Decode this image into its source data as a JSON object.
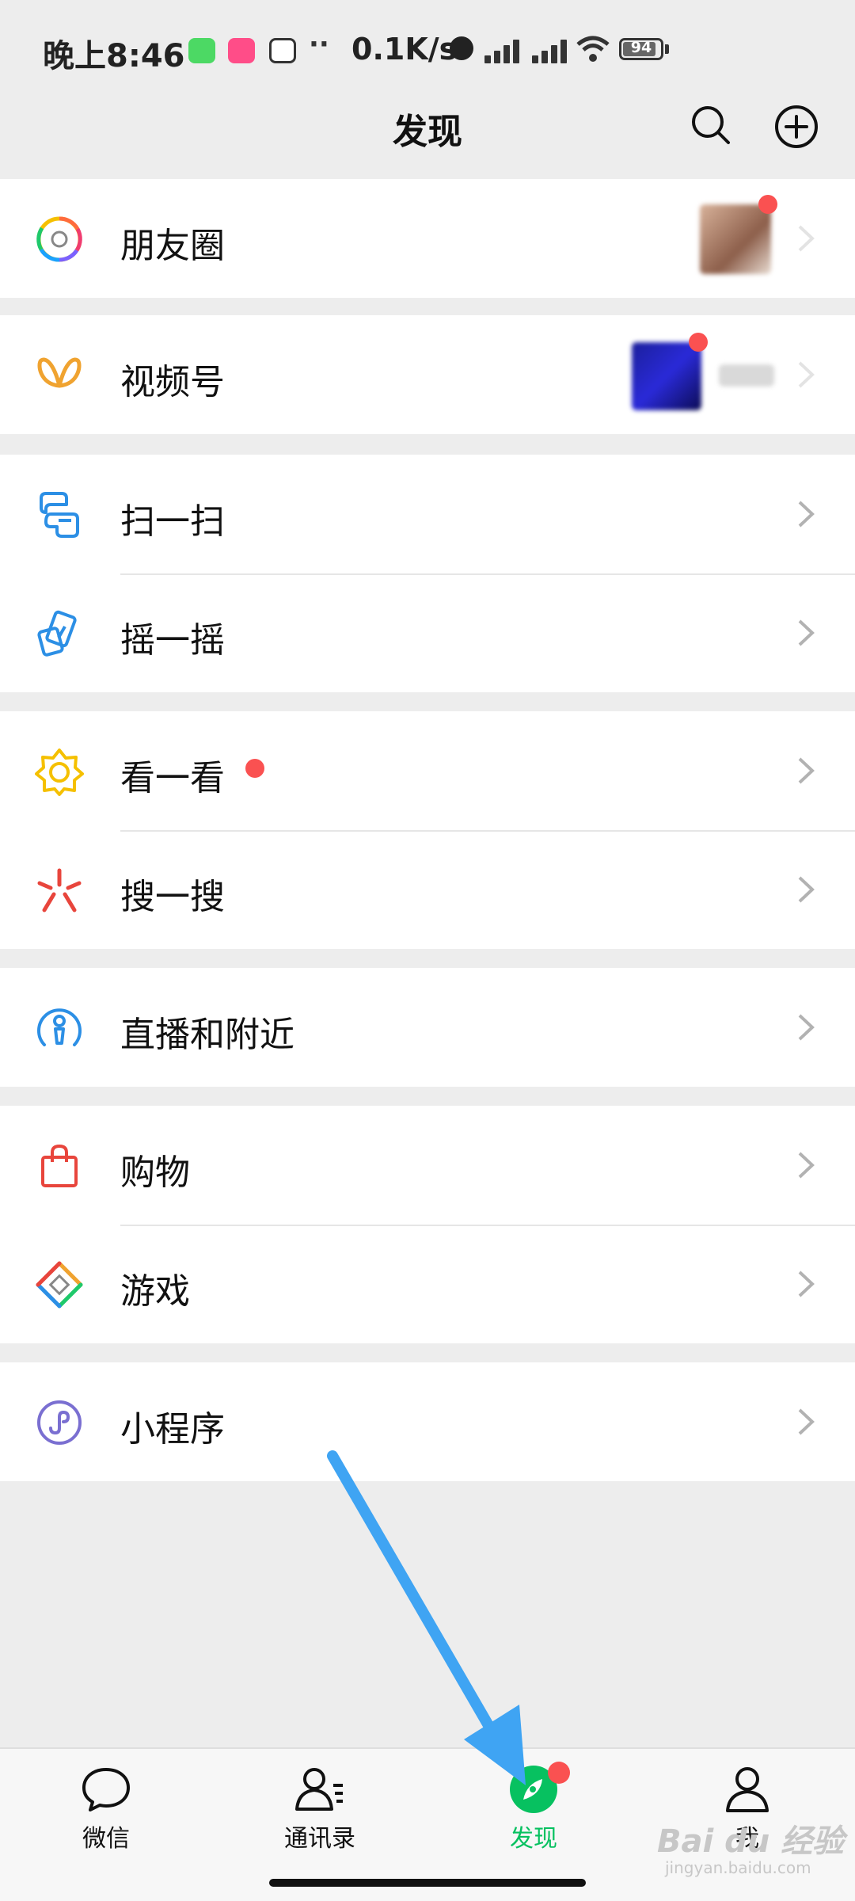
{
  "status_bar": {
    "time": "晚上8:46",
    "network_speed": "0.1K/s",
    "battery_level": "94",
    "app_icon_colors": [
      "#4cd964",
      "#ff4d88",
      "#333333"
    ]
  },
  "nav": {
    "title": "发现",
    "search_icon": "search-icon",
    "add_icon": "plus-circle-icon"
  },
  "groups": [
    {
      "items": [
        {
          "label": "朋友圈",
          "icon": "moments-aperture-icon",
          "has_thumbnail": true,
          "has_red_dot": true
        }
      ]
    },
    {
      "items": [
        {
          "label": "视频号",
          "icon": "channels-butterfly-icon",
          "has_thumbnail": true,
          "has_red_dot": true
        }
      ]
    },
    {
      "items": [
        {
          "label": "扫一扫",
          "icon": "scan-icon"
        },
        {
          "label": "摇一摇",
          "icon": "shake-icon"
        }
      ]
    },
    {
      "items": [
        {
          "label": "看一看",
          "icon": "top-stories-icon",
          "has_red_dot": true
        },
        {
          "label": "搜一搜",
          "icon": "search-spark-icon"
        }
      ]
    },
    {
      "items": [
        {
          "label": "直播和附近",
          "icon": "live-nearby-icon"
        }
      ]
    },
    {
      "items": [
        {
          "label": "购物",
          "icon": "shopping-bag-icon"
        },
        {
          "label": "游戏",
          "icon": "game-diamond-icon"
        }
      ]
    },
    {
      "items": [
        {
          "label": "小程序",
          "icon": "mini-program-icon"
        }
      ]
    }
  ],
  "tab_bar": {
    "tabs": [
      {
        "label": "微信",
        "icon": "chat-bubble-icon",
        "active": false
      },
      {
        "label": "通讯录",
        "icon": "contacts-icon",
        "active": false
      },
      {
        "label": "发现",
        "icon": "compass-icon",
        "active": true,
        "has_red_dot": true
      },
      {
        "label": "我",
        "icon": "person-icon",
        "active": false
      }
    ]
  },
  "colors": {
    "accent_green": "#07c160",
    "badge_red": "#fa5151",
    "annotation_arrow": "#3fa4f3",
    "background": "#ededed"
  },
  "watermark": {
    "text": "Bai du 经验",
    "sub": "jingyan.baidu.com"
  }
}
